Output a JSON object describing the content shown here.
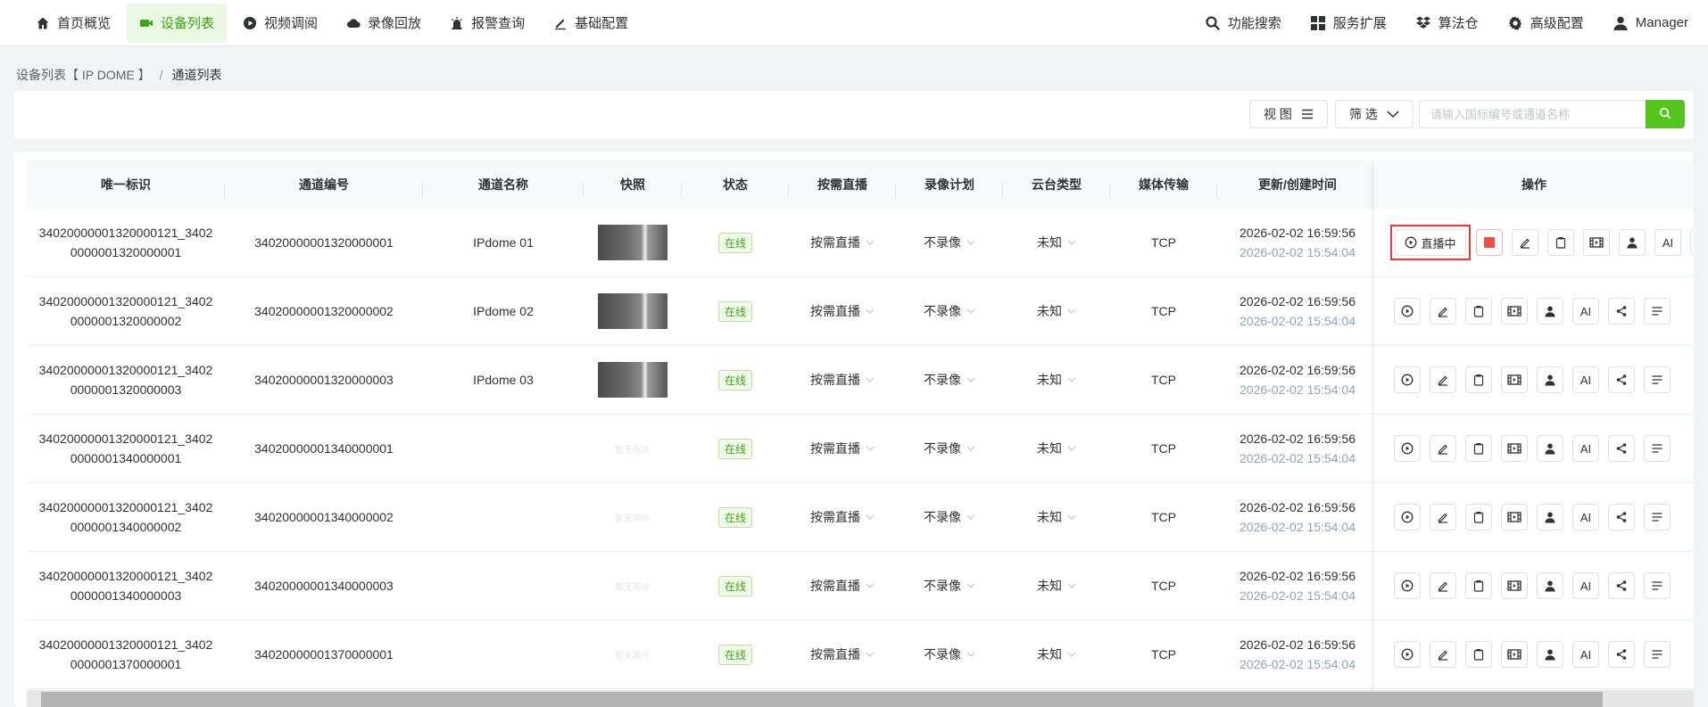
{
  "nav": {
    "left": [
      {
        "label": "首页概览",
        "icon": "home-icon",
        "active": false
      },
      {
        "label": "设备列表",
        "icon": "camera-icon",
        "active": true
      },
      {
        "label": "视频调阅",
        "icon": "play-circle-icon",
        "active": false
      },
      {
        "label": "录像回放",
        "icon": "cloud-icon",
        "active": false
      },
      {
        "label": "报警查询",
        "icon": "alarm-icon",
        "active": false
      },
      {
        "label": "基础配置",
        "icon": "edit-icon",
        "active": false
      }
    ],
    "right": [
      {
        "label": "功能搜索",
        "icon": "search-icon"
      },
      {
        "label": "服务扩展",
        "icon": "grid-icon"
      },
      {
        "label": "算法仓",
        "icon": "dropbox-icon"
      },
      {
        "label": "高级配置",
        "icon": "gear-icon"
      },
      {
        "label": "Manager",
        "icon": "user-icon"
      }
    ]
  },
  "breadcrumb": {
    "parent": "设备列表【 IP DOME 】",
    "separator": "/",
    "current": "通道列表"
  },
  "toolbar": {
    "view_label": "视 图",
    "filter_label": "筛 选",
    "search_placeholder": "请输入国标编号或通道名称"
  },
  "table": {
    "headers": [
      "唯一标识",
      "通道编号",
      "通道名称",
      "快照",
      "状态",
      "按需直播",
      "录像计划",
      "云台类型",
      "媒体传输",
      "更新/创建时间",
      "操作"
    ],
    "no_snapshot_text": "暂无照片",
    "rows": [
      {
        "uid1": "34020000001320000121_3402",
        "uid2": "0000001320000001",
        "channel_no": "34020000001320000001",
        "name": "IPdome 01",
        "snapshot": true,
        "status": "在线",
        "on_demand": "按需直播",
        "record": "不录像",
        "ptz": "未知",
        "transport": "TCP",
        "updated": "2026-02-02 16:59:56",
        "created": "2026-02-02 15:54:04",
        "live": true
      },
      {
        "uid1": "34020000001320000121_3402",
        "uid2": "0000001320000002",
        "channel_no": "34020000001320000002",
        "name": "IPdome 02",
        "snapshot": true,
        "status": "在线",
        "on_demand": "按需直播",
        "record": "不录像",
        "ptz": "未知",
        "transport": "TCP",
        "updated": "2026-02-02 16:59:56",
        "created": "2026-02-02 15:54:04",
        "live": false
      },
      {
        "uid1": "34020000001320000121_3402",
        "uid2": "0000001320000003",
        "channel_no": "34020000001320000003",
        "name": "IPdome 03",
        "snapshot": true,
        "status": "在线",
        "on_demand": "按需直播",
        "record": "不录像",
        "ptz": "未知",
        "transport": "TCP",
        "updated": "2026-02-02 16:59:56",
        "created": "2026-02-02 15:54:04",
        "live": false
      },
      {
        "uid1": "34020000001320000121_3402",
        "uid2": "0000001340000001",
        "channel_no": "34020000001340000001",
        "name": "",
        "snapshot": false,
        "status": "在线",
        "on_demand": "按需直播",
        "record": "不录像",
        "ptz": "未知",
        "transport": "TCP",
        "updated": "2026-02-02 16:59:56",
        "created": "2026-02-02 15:54:04",
        "live": false
      },
      {
        "uid1": "34020000001320000121_3402",
        "uid2": "0000001340000002",
        "channel_no": "34020000001340000002",
        "name": "",
        "snapshot": false,
        "status": "在线",
        "on_demand": "按需直播",
        "record": "不录像",
        "ptz": "未知",
        "transport": "TCP",
        "updated": "2026-02-02 16:59:56",
        "created": "2026-02-02 15:54:04",
        "live": false
      },
      {
        "uid1": "34020000001320000121_3402",
        "uid2": "0000001340000003",
        "channel_no": "34020000001340000003",
        "name": "",
        "snapshot": false,
        "status": "在线",
        "on_demand": "按需直播",
        "record": "不录像",
        "ptz": "未知",
        "transport": "TCP",
        "updated": "2026-02-02 16:59:56",
        "created": "2026-02-02 15:54:04",
        "live": false
      },
      {
        "uid1": "34020000001320000121_3402",
        "uid2": "0000001370000001",
        "channel_no": "34020000001370000001",
        "name": "",
        "snapshot": false,
        "status": "在线",
        "on_demand": "按需直播",
        "record": "不录像",
        "ptz": "未知",
        "transport": "TCP",
        "updated": "2026-02-02 16:59:56",
        "created": "2026-02-02 15:54:04",
        "live": false
      }
    ]
  },
  "ops": {
    "live_label": "直播中",
    "ai_label": "AI",
    "buttons": [
      "play-icon",
      "edit-icon",
      "clipboard-icon",
      "film-icon",
      "person-icon",
      "ai-button",
      "share-icon",
      "list-icon"
    ]
  },
  "colors": {
    "accent": "#52c41a",
    "accent_text": "#3aa60f",
    "highlight_border": "#e53935",
    "stop_red": "#f04e4e"
  }
}
